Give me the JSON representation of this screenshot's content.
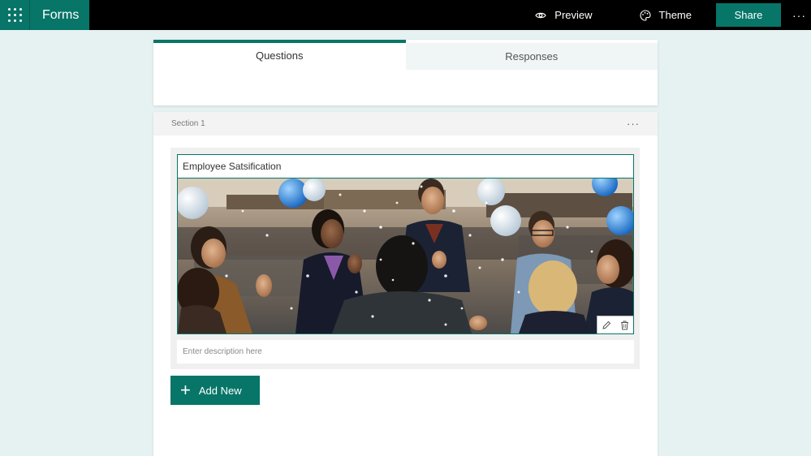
{
  "app": {
    "title": "Forms"
  },
  "topbar": {
    "preview_label": "Preview",
    "theme_label": "Theme",
    "share_label": "Share",
    "more_label": "···"
  },
  "tabs": [
    {
      "label": "Questions",
      "active": true
    },
    {
      "label": "Responses",
      "active": false
    }
  ],
  "section": {
    "label": "Section 1",
    "more_label": "···"
  },
  "form": {
    "title": "Employee Satsification",
    "description_placeholder": "Enter description here",
    "image_alt": "People celebrating in an office with balloons and confetti"
  },
  "add_new_label": "Add New",
  "colors": {
    "accent": "#077568",
    "background": "#e6f1f2",
    "topbar": "#000000"
  },
  "icons": {
    "app_launcher": "waffle-icon",
    "preview": "eye-icon",
    "theme": "palette-icon",
    "edit": "pencil-icon",
    "delete": "trash-icon",
    "add": "plus-icon"
  }
}
